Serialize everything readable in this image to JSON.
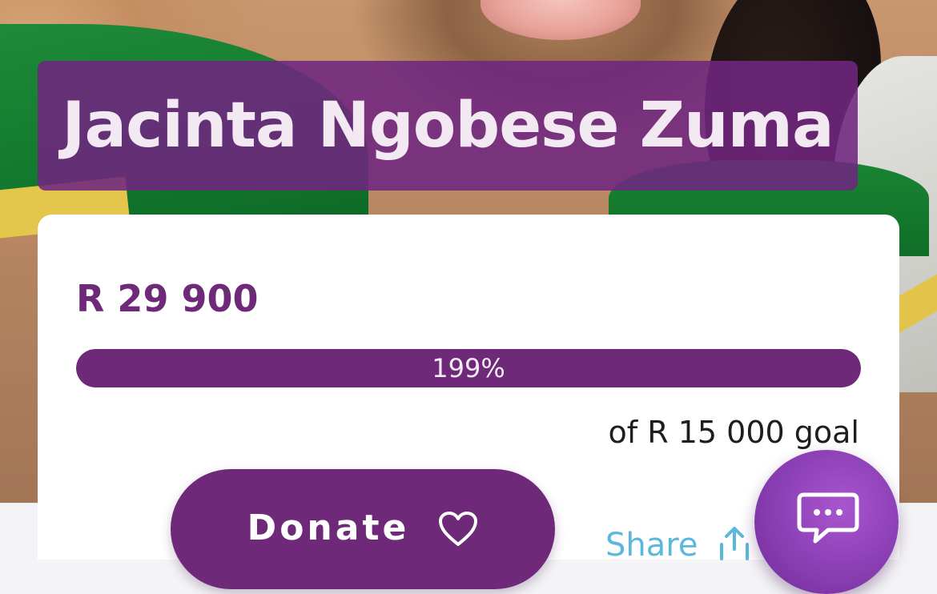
{
  "campaign": {
    "name": "Jacinta Ngobese Zuma"
  },
  "donation": {
    "raised": "R 29 900",
    "progress_label": "199%",
    "progress_fraction": 1.0,
    "goal_text": "of R 15 000 goal"
  },
  "actions": {
    "donate_label": "Donate",
    "share_label": "Share"
  },
  "icons": {
    "donate": "heart-icon",
    "share": "share-icon",
    "chat": "chat-bubble-icon"
  },
  "colors": {
    "brand_purple": "#6e2a78",
    "share_blue": "#5bb8dd",
    "chat_purple": "#8a3eb3"
  }
}
